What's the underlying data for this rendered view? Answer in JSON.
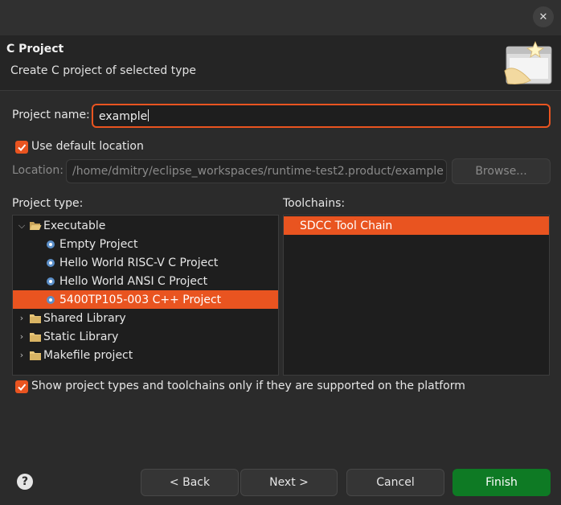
{
  "window": {
    "close_glyph": "✕"
  },
  "header": {
    "title": "C Project",
    "subtitle": "Create C project of selected type"
  },
  "project_name": {
    "label": "Project name:",
    "value": "example"
  },
  "use_default_location": {
    "label": "Use default location",
    "checked": true
  },
  "location": {
    "label": "Location:",
    "value": "/home/dmitry/eclipse_workspaces/runtime-test2.product/example",
    "browse_label": "Browse..."
  },
  "project_type": {
    "label": "Project type:",
    "items": [
      {
        "label": "Executable",
        "kind": "folder",
        "expanded": true
      },
      {
        "label": "Empty Project",
        "kind": "template"
      },
      {
        "label": "Hello World RISC-V C Project",
        "kind": "template"
      },
      {
        "label": "Hello World ANSI C Project",
        "kind": "template"
      },
      {
        "label": "5400TP105-003 C++ Project",
        "kind": "template",
        "selected": true
      },
      {
        "label": "Shared Library",
        "kind": "folder",
        "expanded": false
      },
      {
        "label": "Static Library",
        "kind": "folder",
        "expanded": false
      },
      {
        "label": "Makefile project",
        "kind": "folder",
        "expanded": false
      }
    ]
  },
  "toolchains": {
    "label": "Toolchains:",
    "items": [
      {
        "label": "SDCC Tool Chain",
        "selected": true
      }
    ]
  },
  "show_supported": {
    "label": "Show project types and toolchains only if they are supported on the platform",
    "checked": true
  },
  "buttons": {
    "help": "?",
    "back": "< Back",
    "next": "Next >",
    "cancel": "Cancel",
    "finish": "Finish"
  },
  "colors": {
    "accent": "#e95420",
    "finish": "#0e7a24",
    "background": "#2b2b2b"
  }
}
